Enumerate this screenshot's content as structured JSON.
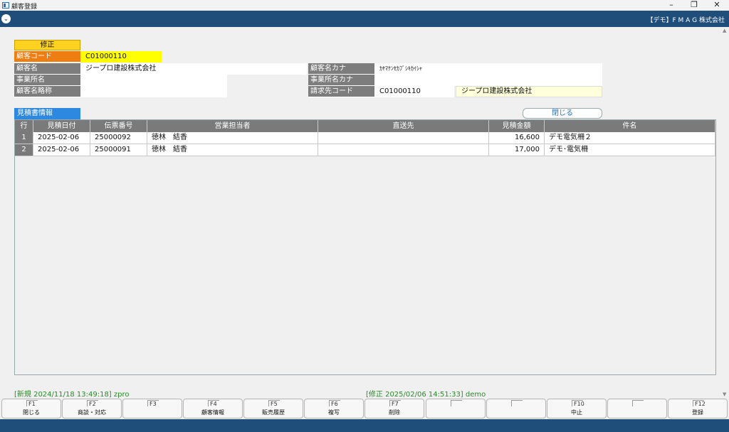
{
  "window": {
    "title": "顧客登録",
    "minimize": "–",
    "restore": "❐",
    "close": "✕"
  },
  "menubar": {
    "menu_icon": "chevron-down-icon",
    "company": "【デモ】F M A G 株式会社"
  },
  "form": {
    "mode": "修正",
    "customer_code_label": "顧客コード",
    "customer_code": "C01000110",
    "customer_name_label": "顧客名",
    "customer_name": "ジープロ建設株式会社",
    "customer_kana_label": "顧客名カナ",
    "customer_kana": "ｶﾔﾏｹﾝｾｶﾌﾞｼｷｶｲｼｬ",
    "office_label": "事業所名",
    "office": "",
    "office_kana_label": "事業所名カナ",
    "office_kana": "",
    "short_name_label": "顧客名略称",
    "short_name": "",
    "billing_code_label": "請求先コード",
    "billing_code": "C01000110",
    "billing_name": "ジープロ建設株式会社"
  },
  "quotes": {
    "section_title": "見積書情報",
    "close_label": "閉じる",
    "columns": [
      "行",
      "見積日付",
      "伝票番号",
      "営業担当者",
      "直送先",
      "見積金額",
      "件名"
    ],
    "rows": [
      {
        "no": "1",
        "date": "2025-02-06",
        "slip": "25000092",
        "rep": "徳林　結香",
        "dest": "",
        "amount": "16,600",
        "subject": "デモ電気柵２"
      },
      {
        "no": "2",
        "date": "2025-02-06",
        "slip": "25000091",
        "rep": "徳林　結香",
        "dest": "",
        "amount": "17,000",
        "subject": "デモ･電気柵"
      }
    ]
  },
  "status": {
    "created": "[新規 2024/11/18 13:49:18] zpro",
    "modified": "[修正 2025/02/06 14:51:33] demo"
  },
  "fkeys": [
    {
      "key": "F1",
      "label": "閉じる"
    },
    {
      "key": "F2",
      "label": "商談・対応"
    },
    {
      "key": "F3",
      "label": ""
    },
    {
      "key": "F4",
      "label": "顧客情報"
    },
    {
      "key": "F5",
      "label": "販売履歴"
    },
    {
      "key": "F6",
      "label": "複写"
    },
    {
      "key": "F7",
      "label": "削除"
    },
    {
      "key": "",
      "label": ""
    },
    {
      "key": "",
      "label": ""
    },
    {
      "key": "F10",
      "label": "中止"
    },
    {
      "key": "",
      "label": ""
    },
    {
      "key": "F12",
      "label": "登録"
    }
  ],
  "colors": {
    "header": "#1f4e7a",
    "label_gray": "#7d7d7d",
    "accent_orange": "#ee7d12",
    "highlight_yellow": "#ffff00",
    "section_blue": "#2d89e0",
    "status_green": "#2a8a2a"
  }
}
